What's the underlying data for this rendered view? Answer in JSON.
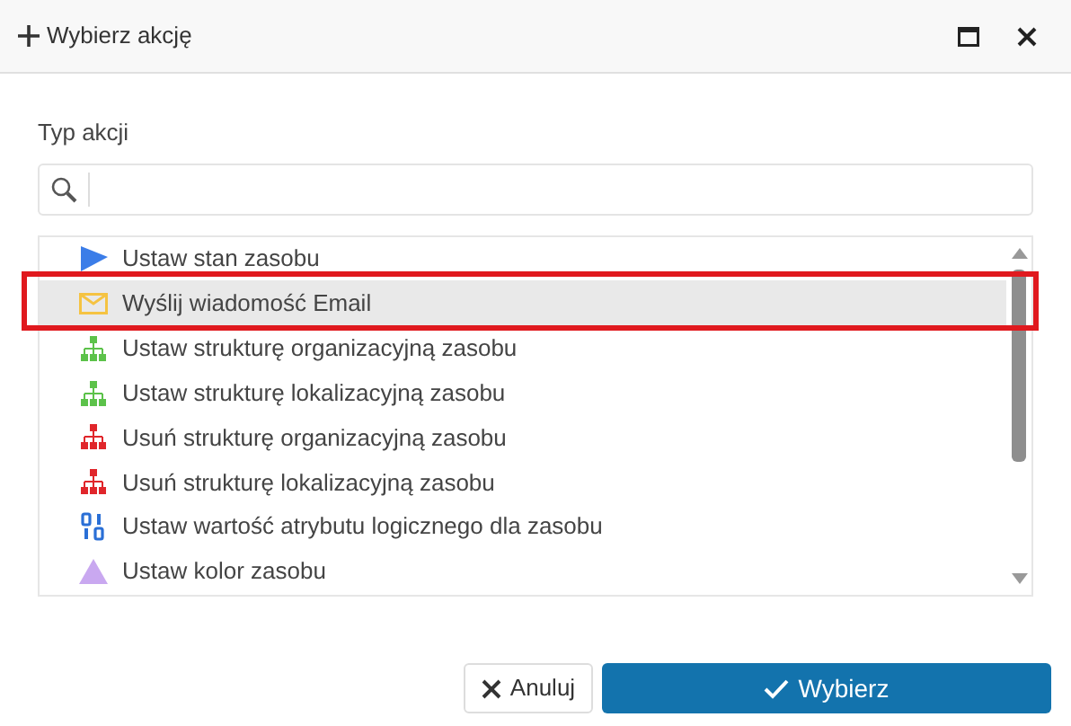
{
  "window": {
    "title": "Wybierz akcję"
  },
  "field_label": "Typ akcji",
  "actions": [
    {
      "label": "Ustaw stan zasobu",
      "kind": "state",
      "selected": false
    },
    {
      "label": "Wyślij wiadomość Email",
      "kind": "email",
      "selected": true
    },
    {
      "label": "Ustaw strukturę organizacyjną zasobu",
      "kind": "set-structure",
      "selected": false
    },
    {
      "label": "Ustaw strukturę lokalizacyjną zasobu",
      "kind": "set-structure",
      "selected": false
    },
    {
      "label": "Usuń strukturę organizacyjną zasobu",
      "kind": "remove-structure",
      "selected": false
    },
    {
      "label": "Usuń strukturę lokalizacyjną zasobu",
      "kind": "remove-structure",
      "selected": false
    },
    {
      "label": "Ustaw wartość atrybutu logicznego dla zasobu",
      "kind": "boolean",
      "selected": false
    },
    {
      "label": "Ustaw kolor zasobu",
      "kind": "color",
      "selected": false
    }
  ],
  "buttons": [
    {
      "label": "Anuluj",
      "kind": "cancel"
    },
    {
      "label": "Wybierz",
      "kind": "primary"
    }
  ]
}
